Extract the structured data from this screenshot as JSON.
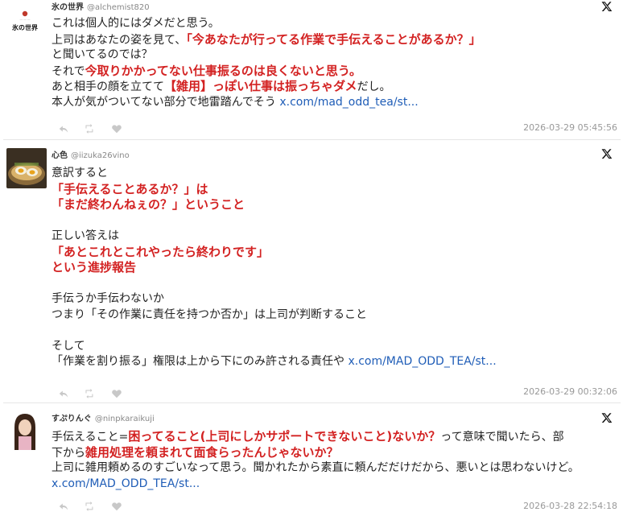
{
  "tweets": [
    {
      "username": "氷の世界",
      "handle": "@alchemist820",
      "avatar_text": "氷の世界",
      "timestamp": "2026-03-29 05:45:56",
      "lines": [
        [
          {
            "t": "これは個人的にはダメだと思う。",
            "s": "n"
          }
        ],
        [
          {
            "t": "上司はあなたの姿を見て、",
            "s": "n"
          },
          {
            "t": "「今あなたが行ってる作業で手伝えることがあるか？」",
            "s": "h"
          }
        ],
        [
          {
            "t": "と聞いてるのでは？",
            "s": "n"
          }
        ],
        [
          {
            "t": "それで",
            "s": "n"
          },
          {
            "t": "今取りかかってない仕事振るのは良くないと思う。",
            "s": "h"
          }
        ],
        [
          {
            "t": "あと相手の顔を立てて",
            "s": "n"
          },
          {
            "t": "【雑用】っぽい仕事は振っちゃダメ",
            "s": "h"
          },
          {
            "t": "だし。",
            "s": "n"
          }
        ],
        [
          {
            "t": "本人が気がついてない部分で地雷踏んでそう ",
            "s": "n"
          },
          {
            "t": "x.com/mad_odd_tea/st...",
            "s": "l"
          }
        ]
      ]
    },
    {
      "username": "心色",
      "handle": "@iizuka26vino",
      "timestamp": "2026-03-29 00:32:06",
      "lines": [
        [
          {
            "t": "意訳すると",
            "s": "n"
          }
        ],
        [
          {
            "t": "「手伝えることあるか？」は",
            "s": "h"
          }
        ],
        [
          {
            "t": "「まだ終わんねぇの？」ということ",
            "s": "h"
          }
        ],
        [],
        [
          {
            "t": "正しい答えは",
            "s": "n"
          }
        ],
        [
          {
            "t": "「あとこれとこれやったら終わりです」",
            "s": "h"
          }
        ],
        [
          {
            "t": "という進捗報告",
            "s": "h"
          }
        ],
        [],
        [
          {
            "t": "手伝うか手伝わないか",
            "s": "n"
          }
        ],
        [
          {
            "t": "つまり「その作業に責任を持つか否か」は上司が判断すること",
            "s": "n"
          }
        ],
        [],
        [
          {
            "t": "そして",
            "s": "n"
          }
        ],
        [
          {
            "t": "「作業を割り振る」権限は上から下にのみ許される責任や ",
            "s": "n"
          },
          {
            "t": "x.com/MAD_ODD_TEA/st...",
            "s": "l"
          }
        ]
      ]
    },
    {
      "username": "すぷりんぐ",
      "handle": "@ninpkaraikuji",
      "timestamp": "2026-03-28 22:54:18",
      "lines": [
        [
          {
            "t": "手伝えること=",
            "s": "n"
          },
          {
            "t": "困ってること(上司にしかサポートできないこと)ないか？",
            "s": "h"
          },
          {
            "t": "って意味で聞いたら、部",
            "s": "n"
          }
        ],
        [
          {
            "t": "下から",
            "s": "n"
          },
          {
            "t": "雑用処理を頼まれて面食らったんじゃないか？",
            "s": "h"
          }
        ],
        [
          {
            "t": "上司に雑用頼めるのすごいなって思う。聞かれたから素直に頼んだだけだから、悪いとは思わないけど。",
            "s": "n"
          }
        ],
        [
          {
            "t": "x.com/MAD_ODD_TEA/st...",
            "s": "l"
          }
        ]
      ]
    }
  ],
  "icons": {
    "close": "x-logo-icon",
    "reply": "reply-icon",
    "retweet": "retweet-icon",
    "like": "heart-icon"
  },
  "colors": {
    "highlight": "#d32222",
    "link": "#1f5db7",
    "timestamp": "#999999",
    "action_icons": "#c8c8c8"
  }
}
